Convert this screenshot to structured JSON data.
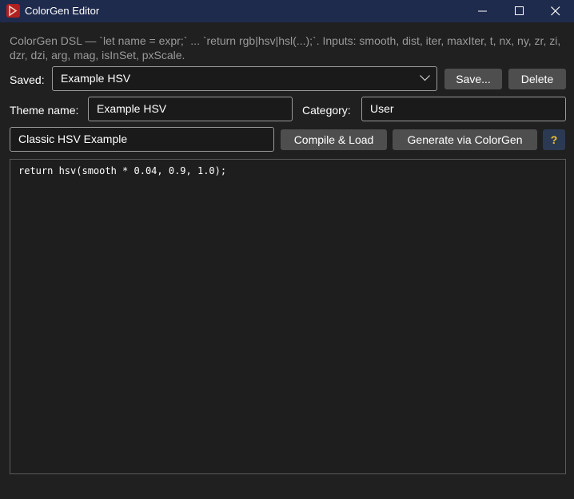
{
  "window": {
    "title": "ColorGen Editor",
    "app_icon": "colorgen-app-icon",
    "minimize_icon": "minimize-icon",
    "maximize_icon": "maximize-icon",
    "close_icon": "close-icon"
  },
  "description": "ColorGen DSL — `let name = expr;` ... `return rgb|hsv|hsl(...);`. Inputs: smooth, dist, iter, maxIter, t, nx, ny, zr, zi, dzr, dzi, arg, mag, isInSet, pxScale.",
  "saved": {
    "label": "Saved:",
    "selected": "Example HSV",
    "arrow_icon": "chevron-down-icon",
    "save_button": "Save...",
    "delete_button": "Delete"
  },
  "theme": {
    "name_label": "Theme name:",
    "name_value": "Example HSV",
    "category_label": "Category:",
    "category_value": "User"
  },
  "actions": {
    "description_value": "Classic HSV Example",
    "compile_button": "Compile & Load",
    "generate_button": "Generate via ColorGen",
    "help_button": "?"
  },
  "editor": {
    "code": "return hsv(smooth * 0.04, 0.9, 1.0);"
  },
  "colors": {
    "titlebar": "#1f2b4d",
    "background": "#202020",
    "field_bg": "#1a1a1a",
    "button_bg": "#4e4e4e",
    "help_bg": "#2b3a52",
    "help_fg": "#f2c230",
    "description_fg": "#9a9a9a"
  }
}
